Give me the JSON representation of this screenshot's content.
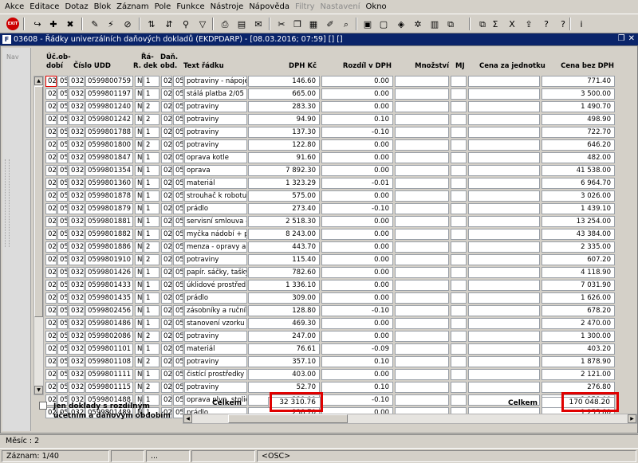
{
  "menu": [
    {
      "label": "Akce",
      "enabled": true
    },
    {
      "label": "Editace",
      "enabled": true
    },
    {
      "label": "Dotaz",
      "enabled": true
    },
    {
      "label": "Blok",
      "enabled": true
    },
    {
      "label": "Záznam",
      "enabled": true
    },
    {
      "label": "Pole",
      "enabled": true
    },
    {
      "label": "Funkce",
      "enabled": true
    },
    {
      "label": "Nástroje",
      "enabled": true
    },
    {
      "label": "Nápověda",
      "enabled": true
    },
    {
      "label": "Filtry",
      "enabled": false
    },
    {
      "label": "Nastavení",
      "enabled": false
    },
    {
      "label": "Okno",
      "enabled": true
    }
  ],
  "toolbar": {
    "exit_label": "EXIT",
    "icons": [
      {
        "name": "exit-icon",
        "glyph": "EXIT"
      },
      {
        "name": "save-icon",
        "glyph": "↪"
      },
      {
        "name": "insert-record-icon",
        "glyph": "✚"
      },
      {
        "name": "delete-record-icon",
        "glyph": "✖"
      },
      {
        "name": "query-enter-icon",
        "glyph": "✎"
      },
      {
        "name": "query-execute-icon",
        "glyph": "⚡"
      },
      {
        "name": "query-cancel-icon",
        "glyph": "⊘"
      },
      {
        "name": "sort-ascending-icon",
        "glyph": "⇅"
      },
      {
        "name": "sort-descending-icon",
        "glyph": "⇵"
      },
      {
        "name": "find-icon",
        "glyph": "⚲"
      },
      {
        "name": "filter-icon",
        "glyph": "▽"
      },
      {
        "name": "print-icon",
        "glyph": "⎙"
      },
      {
        "name": "print-preview-icon",
        "glyph": "▤"
      },
      {
        "name": "email-icon",
        "glyph": "✉"
      },
      {
        "name": "cut-icon",
        "glyph": "✂"
      },
      {
        "name": "copy-icon",
        "glyph": "❐"
      },
      {
        "name": "paste-icon",
        "glyph": "▦"
      },
      {
        "name": "edit-icon",
        "glyph": "✐"
      },
      {
        "name": "lookup-icon",
        "glyph": "⌕"
      },
      {
        "name": "calendar-icon",
        "glyph": "▣"
      },
      {
        "name": "form-icon",
        "glyph": "▢"
      },
      {
        "name": "cube-icon",
        "glyph": "◈"
      },
      {
        "name": "star-icon",
        "glyph": "✲"
      },
      {
        "name": "chart-icon",
        "glyph": "▥"
      },
      {
        "name": "copy-form-icon",
        "glyph": "⧉"
      },
      {
        "name": "copy-form2-icon",
        "glyph": "⧉"
      },
      {
        "name": "sum-icon",
        "glyph": "Σ"
      },
      {
        "name": "excel-icon",
        "glyph": "X"
      },
      {
        "name": "export-icon",
        "glyph": "⇪"
      },
      {
        "name": "help-topic-icon",
        "glyph": "?"
      },
      {
        "name": "help-icon",
        "glyph": "?"
      },
      {
        "name": "info-icon",
        "glyph": "i"
      }
    ]
  },
  "window": {
    "title": "03608 - Řádky univerzálních daňových dokladů (EKDPDARP) - [08.03.2016; 07:59] []  []",
    "app_icon": "F"
  },
  "nav": {
    "label": "Nav"
  },
  "columns": {
    "uc_obdobi_1": "Úč.ob-",
    "uc_obdobi_2": "dobí",
    "cislo_udd": "Číslo UDD",
    "radek_1": "Řá-",
    "radek_2": "R. dek",
    "dan_obd_1": "Daň.",
    "dan_obd_2": "obd.",
    "text_radku": "Text řádku",
    "dph_kc": "DPH Kč",
    "rozdil_dph": "Rozdíl v DPH",
    "mnozstvi": "Množství",
    "mj": "MJ",
    "cena_za_jednotku": "Cena za jednotku",
    "cena_bez_dph": "Cena bez DPH"
  },
  "rows": [
    [
      "02",
      "05",
      "032",
      "0599800759",
      "N",
      "1",
      "02",
      "05",
      "potraviny - nápoje",
      "146.60",
      "0.00",
      "",
      "",
      "",
      "771.40"
    ],
    [
      "02",
      "05",
      "032",
      "0599801197",
      "N",
      "1",
      "02",
      "05",
      "stálá platba 2/05",
      "665.00",
      "0.00",
      "",
      "",
      "",
      "3 500.00"
    ],
    [
      "02",
      "05",
      "032",
      "0599801240",
      "N",
      "2",
      "02",
      "05",
      "potraviny",
      "283.30",
      "0.00",
      "",
      "",
      "",
      "1 490.70"
    ],
    [
      "02",
      "05",
      "032",
      "0599801242",
      "N",
      "2",
      "02",
      "05",
      "potraviny",
      "94.90",
      "0.10",
      "",
      "",
      "",
      "498.90"
    ],
    [
      "02",
      "05",
      "032",
      "0599801788",
      "N",
      "1",
      "02",
      "05",
      "potraviny",
      "137.30",
      "-0.10",
      "",
      "",
      "",
      "722.70"
    ],
    [
      "02",
      "05",
      "032",
      "0599801800",
      "N",
      "2",
      "02",
      "05",
      "potraviny",
      "122.80",
      "0.00",
      "",
      "",
      "",
      "646.20"
    ],
    [
      "02",
      "05",
      "032",
      "0599801847",
      "N",
      "1",
      "02",
      "05",
      "oprava kotle",
      "91.60",
      "0.00",
      "",
      "",
      "",
      "482.00"
    ],
    [
      "02",
      "05",
      "032",
      "0599801354",
      "N",
      "1",
      "02",
      "05",
      "oprava",
      "7 892.30",
      "0.00",
      "",
      "",
      "",
      "41 538.00"
    ],
    [
      "02",
      "05",
      "032",
      "0599801360",
      "N",
      "1",
      "02",
      "05",
      "materiál",
      "1 323.29",
      "-0.01",
      "",
      "",
      "",
      "6 964.70"
    ],
    [
      "02",
      "05",
      "032",
      "0599801878",
      "N",
      "1",
      "02",
      "05",
      "strouhač k robotu, 1",
      "575.00",
      "0.00",
      "",
      "",
      "",
      "3 026.00"
    ],
    [
      "02",
      "05",
      "032",
      "0599801879",
      "N",
      "1",
      "02",
      "05",
      "prádlo",
      "273.40",
      "-0.10",
      "",
      "",
      "",
      "1 439.10"
    ],
    [
      "02",
      "05",
      "032",
      "0599801881",
      "N",
      "1",
      "02",
      "05",
      "servisní smlouva - I",
      "2 518.30",
      "0.00",
      "",
      "",
      "",
      "13 254.00"
    ],
    [
      "02",
      "05",
      "032",
      "0599801882",
      "N",
      "1",
      "02",
      "05",
      "myčka nádobí + pře",
      "8 243.00",
      "0.00",
      "",
      "",
      "",
      "43 384.00"
    ],
    [
      "02",
      "05",
      "032",
      "0599801886",
      "N",
      "2",
      "02",
      "05",
      "menza - opravy a ú",
      "443.70",
      "0.00",
      "",
      "",
      "",
      "2 335.00"
    ],
    [
      "02",
      "05",
      "032",
      "0599801910",
      "N",
      "2",
      "02",
      "05",
      "potraviny",
      "115.40",
      "0.00",
      "",
      "",
      "",
      "607.20"
    ],
    [
      "02",
      "05",
      "032",
      "0599801426",
      "N",
      "1",
      "02",
      "05",
      "papír. sáčky, tašky,",
      "782.60",
      "0.00",
      "",
      "",
      "",
      "4 118.90"
    ],
    [
      "02",
      "05",
      "032",
      "0599801433",
      "N",
      "1",
      "02",
      "05",
      "úklidové prostředky",
      "1 336.10",
      "0.00",
      "",
      "",
      "",
      "7 031.90"
    ],
    [
      "02",
      "05",
      "032",
      "0599801435",
      "N",
      "1",
      "02",
      "05",
      "prádlo",
      "309.00",
      "0.00",
      "",
      "",
      "",
      "1 626.00"
    ],
    [
      "02",
      "05",
      "032",
      "0599802456",
      "N",
      "1",
      "02",
      "05",
      "zásobníky a ručník",
      "128.80",
      "-0.10",
      "",
      "",
      "",
      "678.20"
    ],
    [
      "02",
      "05",
      "032",
      "0599801486",
      "N",
      "1",
      "02",
      "05",
      "stanovení vzorku",
      "469.30",
      "0.00",
      "",
      "",
      "",
      "2 470.00"
    ],
    [
      "02",
      "05",
      "032",
      "0599802086",
      "N",
      "2",
      "02",
      "05",
      "potraviny",
      "247.00",
      "0.00",
      "",
      "",
      "",
      "1 300.00"
    ],
    [
      "02",
      "05",
      "032",
      "0599801101",
      "N",
      "1",
      "02",
      "05",
      "materiál",
      "76.61",
      "-0.09",
      "",
      "",
      "",
      "403.20"
    ],
    [
      "02",
      "05",
      "032",
      "0599801108",
      "N",
      "2",
      "02",
      "05",
      "potraviny",
      "357.10",
      "0.10",
      "",
      "",
      "",
      "1 878.90"
    ],
    [
      "02",
      "05",
      "032",
      "0599801111",
      "N",
      "1",
      "02",
      "05",
      "čistící prostředky",
      "403.00",
      "0.00",
      "",
      "",
      "",
      "2 121.00"
    ],
    [
      "02",
      "05",
      "032",
      "0599801115",
      "N",
      "2",
      "02",
      "05",
      "potraviny",
      "52.70",
      "0.10",
      "",
      "",
      "",
      "276.80"
    ],
    [
      "02",
      "05",
      "032",
      "0599801488",
      "N",
      "1",
      "02",
      "05",
      "oprava plyn. stoličk",
      "239.00",
      "-0.10",
      "",
      "",
      "",
      "1 258.00"
    ],
    [
      "02",
      "05",
      "032",
      "0599801489",
      "N",
      "1",
      "02",
      "05",
      "prádlo",
      "238.70",
      "0.00",
      "",
      "",
      "",
      "1 255.80"
    ]
  ],
  "footer": {
    "celkem_label_1": "Celkem",
    "celkem_dph": "32 310.76",
    "celkem_label_2": "Celkem",
    "celkem_bez_dph": "170 048.20",
    "checkbox_label": "Jen doklady s rozdílným účetním a daňovým obdobím",
    "checkbox_checked": false
  },
  "status": {
    "line1": "Měsíc : 2",
    "record": "Záznam: 1/40",
    "seg2": "",
    "seg3": "...",
    "seg4": "",
    "osc": "<OSC>"
  },
  "colors": {
    "title_bar": "#0a246a",
    "highlight": "#e00000",
    "background": "#d4d0c8"
  }
}
